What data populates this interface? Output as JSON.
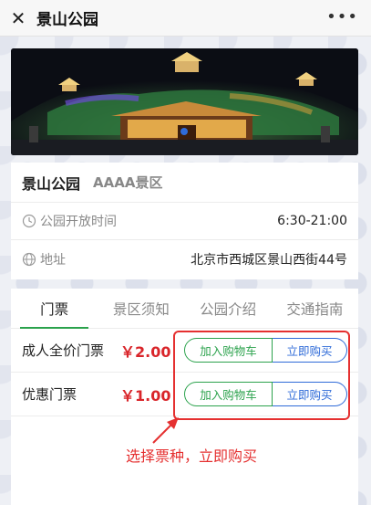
{
  "topbar": {
    "title": "景山公园",
    "more": "•••"
  },
  "park": {
    "name": "景山公园",
    "level": "AAAA景区",
    "hours_label": "公园开放时间",
    "hours_value": "6:30-21:00",
    "address_label": "地址",
    "address_value": "北京市西城区景山西街44号"
  },
  "tabs": [
    "门票",
    "景区须知",
    "公园介绍",
    "交通指南"
  ],
  "tickets": [
    {
      "name": "成人全价门票",
      "price": "￥2.00",
      "cart_label": "加入购物车",
      "buy_label": "立即购买"
    },
    {
      "name": "优惠门票",
      "price": "￥1.00",
      "cart_label": "加入购物车",
      "buy_label": "立即购买"
    }
  ],
  "annotation": "选择票种，立即购买",
  "colors": {
    "accent_green": "#2ba24c",
    "accent_blue": "#2f6bd8",
    "price_red": "#d9252a",
    "annotation_red": "#e53030"
  }
}
